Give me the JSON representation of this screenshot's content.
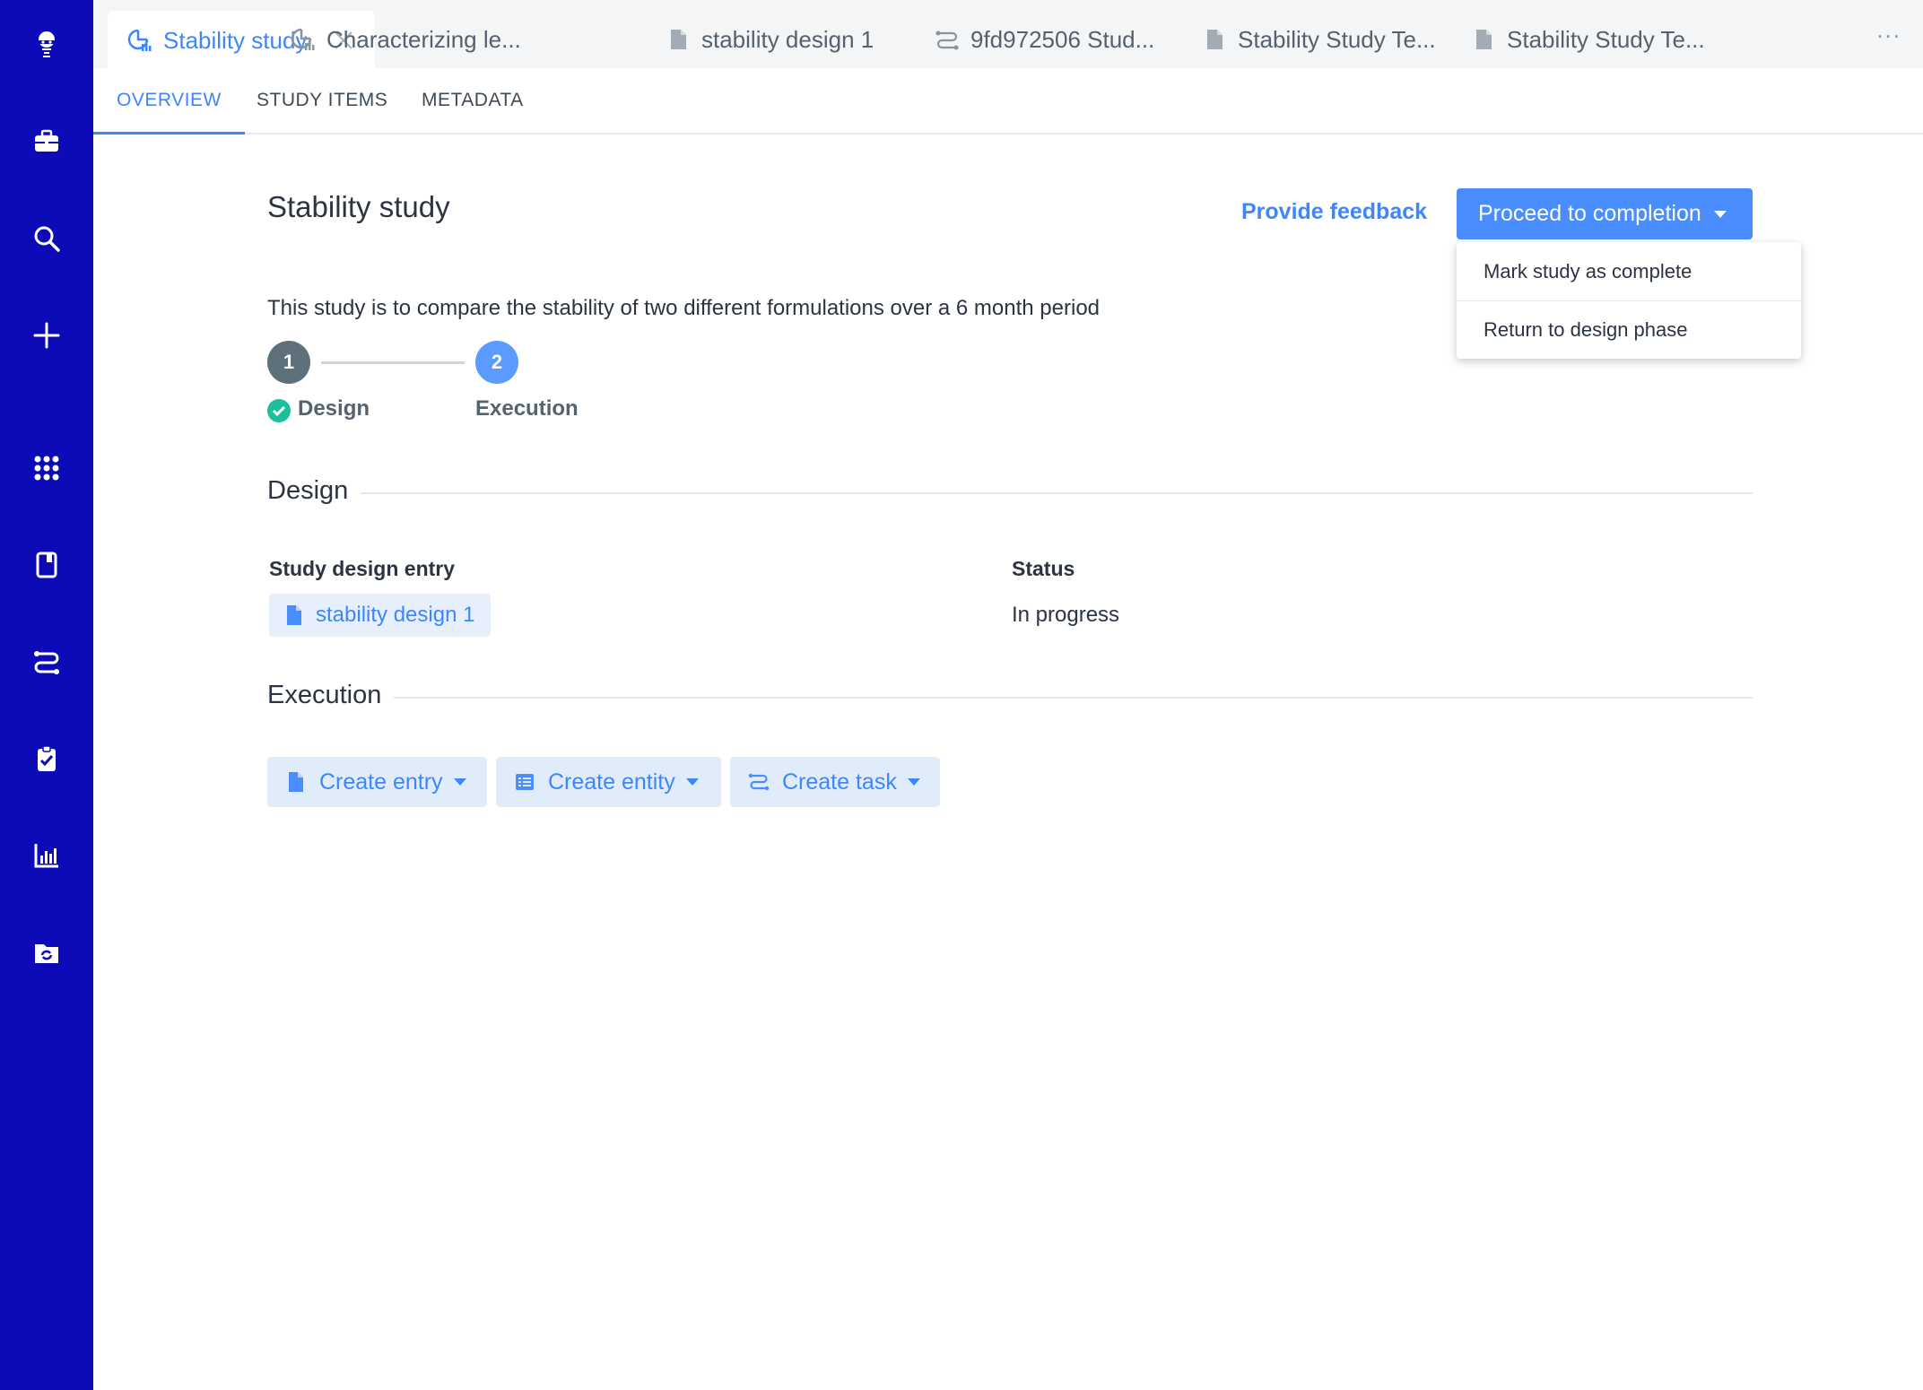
{
  "sidebar": {
    "icons": [
      "logo-icon",
      "briefcase-icon",
      "search-icon",
      "plus-icon",
      "apps-grid-icon",
      "notebook-icon",
      "workflow-icon",
      "clipboard-check-icon",
      "bar-chart-icon",
      "folder-sync-icon"
    ]
  },
  "tabs": [
    {
      "label": "Stability study",
      "icon": "study-icon",
      "active": true
    },
    {
      "label": "Characterizing le...",
      "icon": "study-icon"
    },
    {
      "label": "stability design 1",
      "icon": "document-icon"
    },
    {
      "label": "9fd972506 Stud...",
      "icon": "workflow-icon"
    },
    {
      "label": "Stability Study Te...",
      "icon": "document-icon"
    },
    {
      "label": "Stability Study Te...",
      "icon": "document-icon"
    }
  ],
  "more": "...",
  "subtabs": [
    "OVERVIEW",
    "STUDY ITEMS",
    "METADATA"
  ],
  "page": {
    "title": "Stability study",
    "feedback": "Provide feedback",
    "proceed": "Proceed to completion",
    "description": "This study is to compare the stability of two different formulations over a 6 month period"
  },
  "dropdown": [
    "Mark study as complete",
    "Return to design phase"
  ],
  "stepper": {
    "steps": [
      {
        "number": "1",
        "label": "Design",
        "status": "complete"
      },
      {
        "number": "2",
        "label": "Execution",
        "status": "current"
      }
    ]
  },
  "design": {
    "title": "Design",
    "entry_label": "Study design entry",
    "entry_value": "stability design 1",
    "status_label": "Status",
    "status_value": "In progress"
  },
  "execution": {
    "title": "Execution",
    "buttons": [
      "Create entry",
      "Create entity",
      "Create task"
    ]
  },
  "colors": {
    "sidebar": "#0d0ab8",
    "accent": "#3d86ff",
    "success": "#1bbf9c",
    "step_done": "#5e7079",
    "step_current": "#5b9bff"
  }
}
